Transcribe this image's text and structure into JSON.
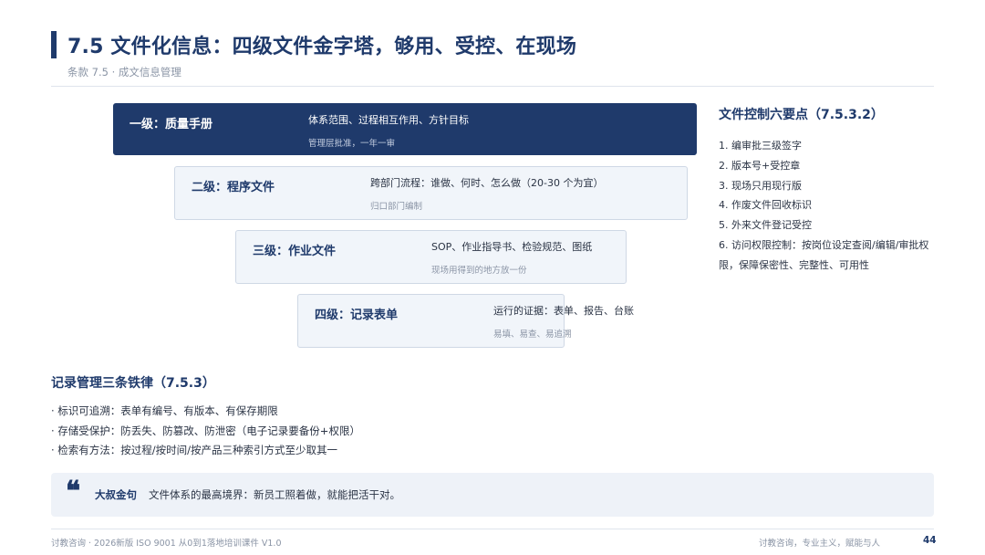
{
  "header": {
    "title": "7.5 文件化信息：四级文件金字塔，够用、受控、在现场",
    "subtitle": "条款 7.5 · 成文信息管理"
  },
  "pyramid": [
    {
      "name": "一级：质量手册",
      "desc": "体系范围、过程相互作用、方针目标",
      "note": "管理层批准，一年一审"
    },
    {
      "name": "二级：程序文件",
      "desc": "跨部门流程：谁做、何时、怎么做（20-30 个为宜）",
      "note": "归口部门编制"
    },
    {
      "name": "三级：作业文件",
      "desc": "SOP、作业指导书、检验规范、图纸",
      "note": "现场用得到的地方放一份"
    },
    {
      "name": "四级：记录表单",
      "desc": "运行的证据：表单、报告、台账",
      "note": "易填、易查、易追溯"
    }
  ],
  "side": {
    "title": "文件控制六要点（7.5.3.2）",
    "items": [
      "1. 编审批三级签字",
      "2. 版本号+受控章",
      "3. 现场只用现行版",
      "4. 作废文件回收标识",
      "5. 外来文件登记受控",
      "6. 访问权限控制：按岗位设定查阅/编辑/审批权限，保障保密性、完整性、可用性"
    ]
  },
  "rules": {
    "title": "记录管理三条铁律（7.5.3）",
    "items": [
      "· 标识可追溯：表单有编号、有版本、有保存期限",
      "· 存储受保护：防丢失、防篡改、防泄密（电子记录要备份+权限）",
      "· 检索有方法：按过程/按时间/按产品三种索引方式至少取其一"
    ]
  },
  "quote": {
    "icon": "quote-mark-icon",
    "label": "大叔金句",
    "text": "文件体系的最高境界：新员工照着做，就能把活干对。"
  },
  "footer": {
    "left": "讨教咨询 · 2026新版 ISO 9001 从0到1落地培训课件 V1.0",
    "right": "讨教咨询，专业主义，赋能与人",
    "page": "44"
  },
  "colors": {
    "primary": "#1f3a6b",
    "tier_bg": "#f1f5fa",
    "muted": "#8a94a5"
  }
}
